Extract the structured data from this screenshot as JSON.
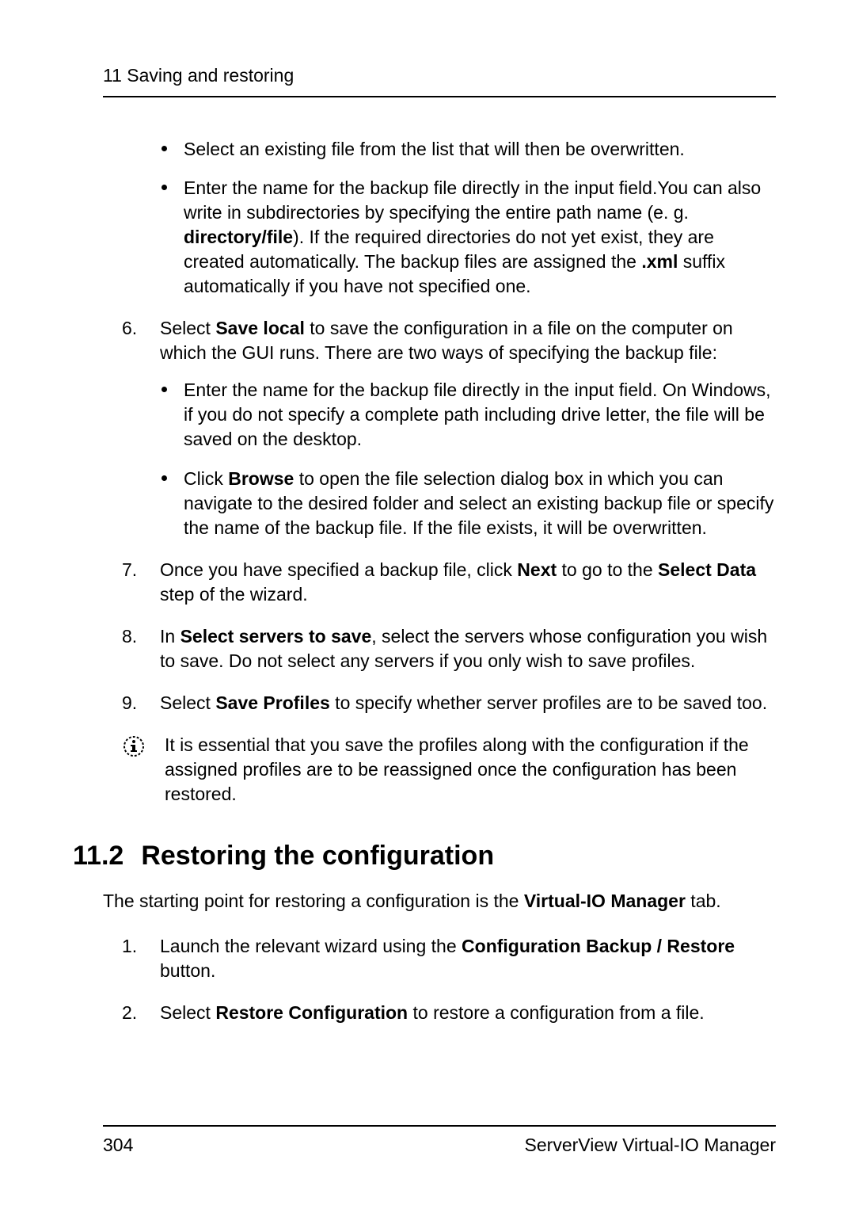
{
  "header": {
    "running": "11 Saving and restoring"
  },
  "bullets_top": [
    {
      "text": "Select an existing file from the list that will then be overwritten."
    },
    {
      "prefix": "Enter the name for the backup file directly in the input field.You can also write in subdirectories by specifying the entire path name (e. g. ",
      "b1": "directory/file",
      "mid1": "). If the required directories do not yet exist, they are created automatically. The backup files are assigned the ",
      "b2": ".xml",
      "suffix": " suffix automatically if you have not specified one."
    }
  ],
  "steps": {
    "s6": {
      "lead_a": "Select ",
      "b": "Save local",
      "lead_b": " to save the configuration in a file on the computer on which the GUI runs. There are two ways of specifying the backup file:",
      "sub1": "Enter the name for the backup file directly in the input field. On Windows, if you do not specify a complete path including drive letter, the file will be saved on the desktop.",
      "sub2_a": "Click ",
      "sub2_b": "Browse",
      "sub2_c": " to open the file selection dialog box in which you can navigate to the desired folder and select an existing backup file or specify the name of the backup file. If the file exists, it will be overwritten."
    },
    "s7": {
      "a": "Once you have specified a backup file, click ",
      "b1": "Next",
      "b": " to go to the ",
      "b2": "Select Data",
      "c": " step of the wizard."
    },
    "s8": {
      "a": "In ",
      "b1": "Select servers to save",
      "b": ", select the servers whose configuration you wish to save. Do not select any servers if you only wish to save profiles."
    },
    "s9": {
      "a": "Select ",
      "b1": "Save Profiles",
      "b": " to specify whether server profiles are to be saved too."
    }
  },
  "note": "It is essential that you save the profiles along with the configuration if the assigned profiles are to be reassigned once the configuration has been restored.",
  "section": {
    "num": "11.2",
    "title": "Restoring the configuration",
    "intro_a": "The starting point for restoring a configuration is the ",
    "intro_b": "Virtual-IO Manager",
    "intro_c": " tab."
  },
  "restore_steps": {
    "s1": {
      "a": "Launch the relevant wizard using the ",
      "b1": "Configuration Backup / Restore",
      "b": " button."
    },
    "s2": {
      "a": "Select ",
      "b1": "Restore Configuration",
      "b": " to restore a configuration from a file."
    }
  },
  "footer": {
    "page": "304",
    "product": "ServerView Virtual-IO Manager"
  }
}
